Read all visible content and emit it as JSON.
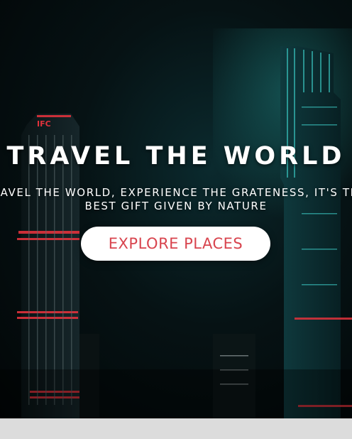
{
  "hero": {
    "title": "TRAVEL THE WORLD",
    "subtitle_line1": "TRAVEL THE WORLD, EXPERIENCE THE GRATENESS, IT'S THE",
    "subtitle_line2": "BEST GIFT GIVEN BY NATURE",
    "cta_label": "EXPLORE PLACES",
    "tower_sign": "IFC"
  },
  "colors": {
    "cta_text": "#d8444e",
    "neon_red": "#e0323c",
    "neon_teal": "#3fd6d0"
  }
}
